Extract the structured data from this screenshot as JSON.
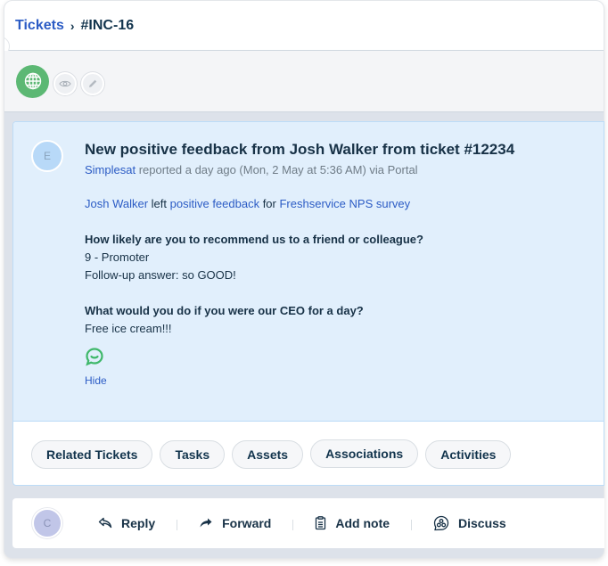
{
  "breadcrumb": {
    "parent": "Tickets",
    "separator": "›",
    "current": "#INC-16"
  },
  "toolbar": {
    "source_icon": "globe-icon",
    "view_icon": "eye-icon",
    "edit_icon": "pencil-icon"
  },
  "ticket": {
    "avatar_initial": "E",
    "title": "New positive feedback from Josh Walker from ticket #12234",
    "meta": {
      "requester": "Simplesat",
      "reported_text": " reported a day ago (Mon, 2 May at 5:36 AM) via Portal"
    },
    "summary": {
      "person": "Josh Walker",
      "left_text": " left ",
      "feedback_link": "positive feedback",
      "for_text": " for ",
      "survey_link": "Freshservice NPS survey"
    },
    "questions": [
      {
        "question": "How likely are you to recommend us to a friend or colleague?",
        "answers": [
          "9 - Promoter",
          "Follow-up answer: so GOOD!"
        ]
      },
      {
        "question": "What would you do if you were our CEO for a day?",
        "answers": [
          "Free ice cream!!!"
        ]
      }
    ],
    "hide_label": "Hide"
  },
  "tabs": [
    {
      "label": "Related Tickets"
    },
    {
      "label": "Tasks"
    },
    {
      "label": "Assets"
    },
    {
      "label": "Associations"
    },
    {
      "label": "Activities"
    }
  ],
  "reply_bar": {
    "avatar_initial": "C",
    "actions": [
      {
        "label": "Reply",
        "icon": "reply-icon"
      },
      {
        "label": "Forward",
        "icon": "forward-icon"
      },
      {
        "label": "Add note",
        "icon": "note-icon"
      },
      {
        "label": "Discuss",
        "icon": "discuss-icon"
      }
    ]
  },
  "colors": {
    "link": "#2c5cc5",
    "text": "#183247",
    "ticket_bg": "#e1effc",
    "globe_green": "#5cb874"
  }
}
